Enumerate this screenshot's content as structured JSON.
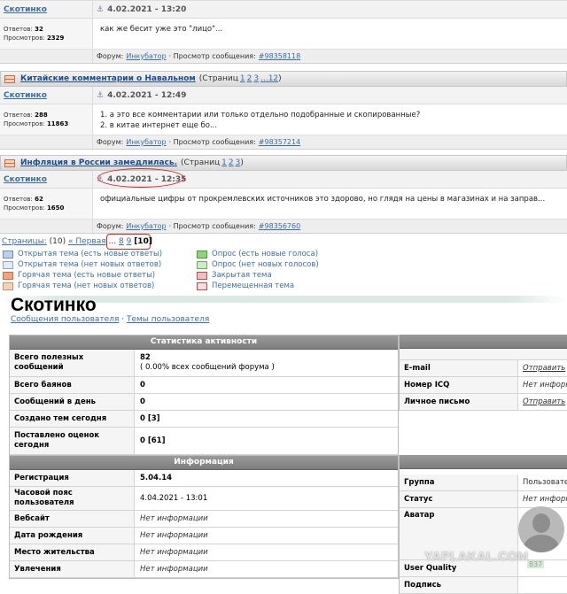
{
  "posts": [
    {
      "title": "",
      "pages_label": "",
      "pages": [],
      "author": "Скотинко",
      "date": "4.02.2021 - 13:20",
      "answers_label": "Ответов:",
      "answers": "32",
      "views_label": "Просмотров:",
      "views": "2329",
      "text": [
        "как же бесит уже это \"лицо\"..."
      ],
      "forum_label": "Форум:",
      "forum": "Инкубатор",
      "view_label": "· Просмотр сообщения:",
      "msg_id": "#98358118"
    },
    {
      "title": "Китайские комментарии о Навальном",
      "pages_label": "(Страниц",
      "pages": [
        "1",
        "2",
        "3",
        "...12"
      ],
      "pages_close": ")",
      "author": "Скотинко",
      "date": "4.02.2021 - 12:49",
      "answers_label": "Ответов:",
      "answers": "288",
      "views_label": "Просмотров:",
      "views": "11863",
      "text": [
        "1. а это все комментарии или только отдельно подобранные и скопированные?",
        "2. в китае интернет еще бо..."
      ],
      "forum_label": "Форум:",
      "forum": "Инкубатор",
      "view_label": "· Просмотр сообщения:",
      "msg_id": "#98357214"
    },
    {
      "title": "Инфляция в России замедлилась.",
      "pages_label": "(Страниц",
      "pages": [
        "1",
        "2",
        "3"
      ],
      "pages_close": ")",
      "author": "Скотинко",
      "date": "4.02.2021 - 12:35",
      "answers_label": "Ответов:",
      "answers": "62",
      "views_label": "Просмотров:",
      "views": "1650",
      "text": [
        "официальные цифры от прокремлевских источников это здорово, но глядя на цены в магазинах и на заправ..."
      ],
      "forum_label": "Форум:",
      "forum": "Инкубатор",
      "view_label": "· Просмотр сообщения:",
      "msg_id": "#98356760"
    }
  ],
  "pagination": {
    "label": "Страницы:",
    "count": "(10)",
    "first": "« Первая",
    "dots": "...",
    "prev": "8",
    "next9": "9",
    "current": "[10]"
  },
  "legend_left": [
    {
      "label": "Открытая тема (есть новые ответы)",
      "border": "#6a8cc7",
      "fill": "#bcd0ee"
    },
    {
      "label": "Открытая тема (нет новых ответов)",
      "border": "#8fa6c9",
      "fill": "#e3eaf5"
    },
    {
      "label": "Горячая тема (есть новые ответы)",
      "border": "#d06a3c",
      "fill": "#f3a37c"
    },
    {
      "label": "Горячая тема (нет новых ответов)",
      "border": "#d08a6c",
      "fill": "#f6d2b8"
    }
  ],
  "legend_right": [
    {
      "label": "Опрос (есть новые голоса)",
      "border": "#4a9a3c",
      "fill": "#8fd47c"
    },
    {
      "label": "Опрос (нет новых голосов)",
      "border": "#6aa86a",
      "fill": "#cfeac9"
    },
    {
      "label": "Закрытая тема",
      "border": "#c54a4a",
      "fill": "#f0c0c0"
    },
    {
      "label": "Перемещенная тема",
      "border": "#c54a4a",
      "fill": "#f6dede"
    }
  ],
  "profile": {
    "name": "Скотинко",
    "link_messages": "Сообщения пользователя",
    "separator": " · ",
    "link_topics": "Темы пользователя"
  },
  "activity": {
    "header": "Статистика активности",
    "rows": [
      {
        "key": "Всего полезных сообщений",
        "value": "82",
        "sub": "( 0.00% всех сообщений форума )"
      },
      {
        "key": "Всего баянов",
        "value": "0",
        "sub": ""
      },
      {
        "key": "Сообщений в день",
        "value": "0",
        "sub": ""
      },
      {
        "key": "Создано тем сегодня",
        "value": "0 [3]",
        "sub": ""
      },
      {
        "key": "Поставлено оценок сегодня",
        "value": "0 [61]",
        "sub": ""
      }
    ]
  },
  "information": {
    "header": "Информация",
    "rows": [
      {
        "key": "Регистрация",
        "value": "5.04.14"
      },
      {
        "key": "Часовой пояс пользователя",
        "value": "4.04.2021 - 13:01"
      },
      {
        "key": "Вебсайт",
        "value": "Нет информации"
      },
      {
        "key": "Дата рождения",
        "value": "Нет информации"
      },
      {
        "key": "Место жительства",
        "value": "Нет информации"
      },
      {
        "key": "Увлечения",
        "value": "Нет информации"
      }
    ]
  },
  "contacts": [
    {
      "key": "E-mail",
      "value": "Отправить"
    },
    {
      "key": "Номер ICQ",
      "value": "Нет информации"
    },
    {
      "key": "Личное письмо",
      "value": "Отправить"
    }
  ],
  "personal": [
    {
      "key": "Группа",
      "value": "Пользователи"
    },
    {
      "key": "Статус",
      "value": "Нет информации"
    },
    {
      "key": "Аватар",
      "value": ""
    },
    {
      "key": "User Quality",
      "value": ""
    },
    {
      "key": "Подпись",
      "value": ""
    }
  ],
  "watermark": "YAPLAKAL.COM",
  "badge": "837"
}
